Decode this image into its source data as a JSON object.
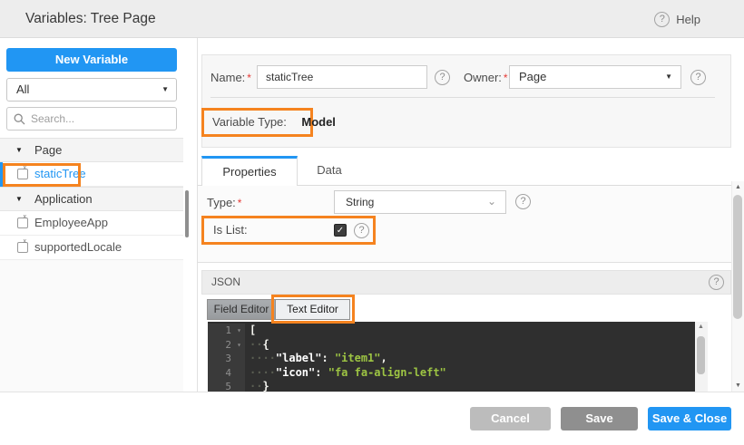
{
  "window": {
    "title": "Variables: Tree Page"
  },
  "header": {
    "help_label": "Help"
  },
  "icons": {
    "help_question": "?",
    "caret_down": "▼",
    "chevron_down": "⌄",
    "fold_caret": "▾",
    "scroll_up": "▲",
    "scroll_down": "▼",
    "checkmark": "✓",
    "variable_x": "x"
  },
  "sidebar": {
    "new_variable_label": "New Variable",
    "filter_value": "All",
    "search_placeholder": "Search...",
    "groups": [
      {
        "label": "Page"
      },
      {
        "label": "Application"
      }
    ],
    "items": {
      "static_tree": "staticTree",
      "employee_app": "EmployeeApp",
      "supported_locale": "supportedLocale"
    }
  },
  "form": {
    "name_label": "Name:",
    "required_marker": "*",
    "name_value": "staticTree",
    "owner_label": "Owner:",
    "owner_value": "Page",
    "variable_type_label": "Variable Type:",
    "variable_type_value": "Model"
  },
  "tabs": {
    "properties_label": "Properties",
    "data_label": "Data"
  },
  "properties": {
    "type_label": "Type:",
    "type_value": "String",
    "is_list_label": "Is List:",
    "is_list_checked": true
  },
  "json_section": {
    "title": "JSON",
    "field_editor_label": "Field Editor",
    "text_editor_label": "Text Editor",
    "code": {
      "lines": [
        {
          "num": "1",
          "fold": "▾",
          "bracket": "["
        },
        {
          "num": "2",
          "fold": "▾",
          "indent": "··",
          "bracket": "{"
        },
        {
          "num": "3",
          "indent": "····",
          "key": "\"label\"",
          "sep": ": ",
          "value": "\"item1\"",
          "tail": ","
        },
        {
          "num": "4",
          "indent": "····",
          "key": "\"icon\"",
          "sep": ": ",
          "value": "\"fa fa-align-left\""
        },
        {
          "num": "5",
          "indent": "··",
          "bracket": "}"
        }
      ]
    }
  },
  "footer": {
    "cancel_label": "Cancel",
    "save_label": "Save",
    "save_close_label": "Save & Close"
  },
  "colors": {
    "accent_blue": "#2196f3",
    "highlight_orange": "#f5831f",
    "code_value_green": "#9dc443"
  }
}
